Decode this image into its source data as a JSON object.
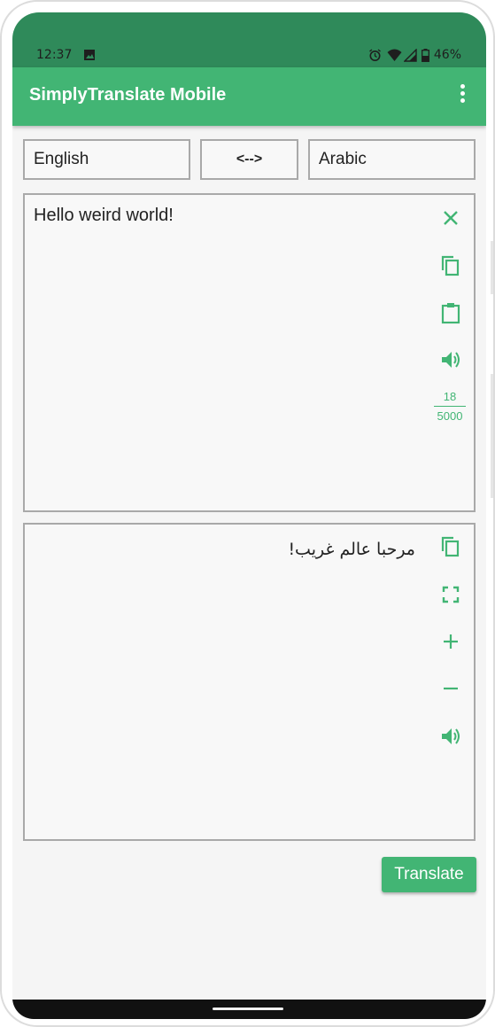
{
  "status_bar": {
    "time": "12:37",
    "battery": "46%",
    "icons": [
      "image-icon",
      "alarm-icon",
      "wifi-icon",
      "signal-icon",
      "battery-icon"
    ]
  },
  "app_bar": {
    "title": "SimplyTranslate Mobile",
    "menu_icon": "more-vert-icon"
  },
  "languages": {
    "from": "English",
    "swap_label": "<-->",
    "to": "Arabic"
  },
  "input": {
    "text": "Hello weird world!",
    "char_count": "18",
    "char_limit": "5000",
    "actions": [
      "close-icon",
      "copy-icon",
      "paste-icon",
      "speaker-icon"
    ]
  },
  "output": {
    "text": "مرحبا عالم غريب!",
    "actions": [
      "copy-icon",
      "fullscreen-icon",
      "plus-icon",
      "minus-icon",
      "speaker-icon"
    ]
  },
  "translate_button": "Translate",
  "colors": {
    "accent": "#42b574",
    "status_bar": "#2f8a5a"
  }
}
